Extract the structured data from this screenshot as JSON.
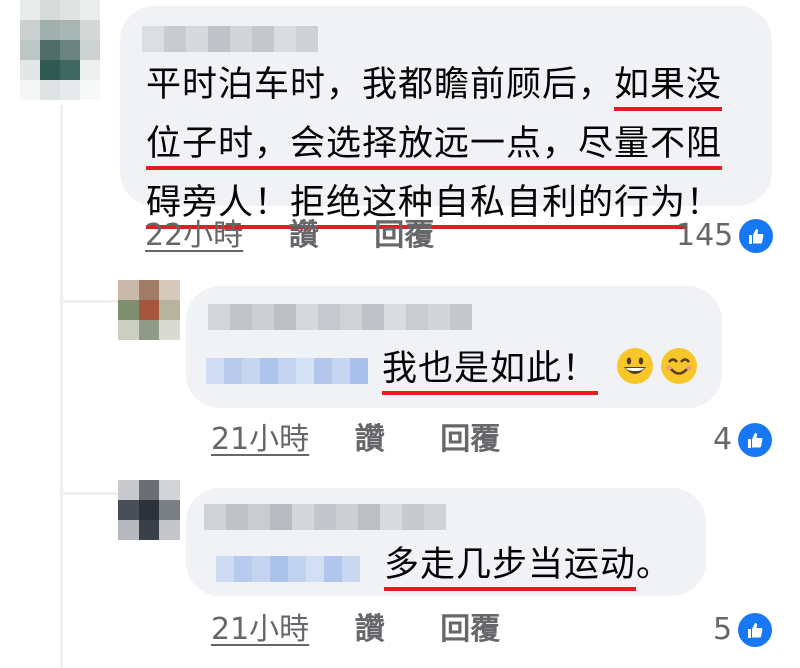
{
  "comments": [
    {
      "text_lines": [
        {
          "plain": "平时泊车时，我都瞻前顾后，",
          "marked": "如果没"
        },
        {
          "plain": "",
          "marked": "位子时，会选择放远一点，尽量不阻"
        },
        {
          "plain": "",
          "marked": "碍旁人！拒绝这种自私自利的行为",
          "tail": "！"
        }
      ],
      "time": "22小時",
      "like_label": "讚",
      "reply_label": "回覆",
      "likes": "145"
    },
    {
      "text": "我也是如此！",
      "time": "21小時",
      "like_label": "讚",
      "reply_label": "回覆",
      "likes": "4",
      "emojis": [
        "grinning-face",
        "smiling-face"
      ]
    },
    {
      "text": "多走几步当运动",
      "tail": "。",
      "time": "21小時",
      "like_label": "讚",
      "reply_label": "回覆",
      "likes": "5"
    }
  ],
  "colors": {
    "bubble": "#f0f2f5",
    "underline": "#e02020",
    "meta_text": "#65676b",
    "like_blue": "#1877f2"
  },
  "icons": [
    "thumbs-up-icon"
  ]
}
